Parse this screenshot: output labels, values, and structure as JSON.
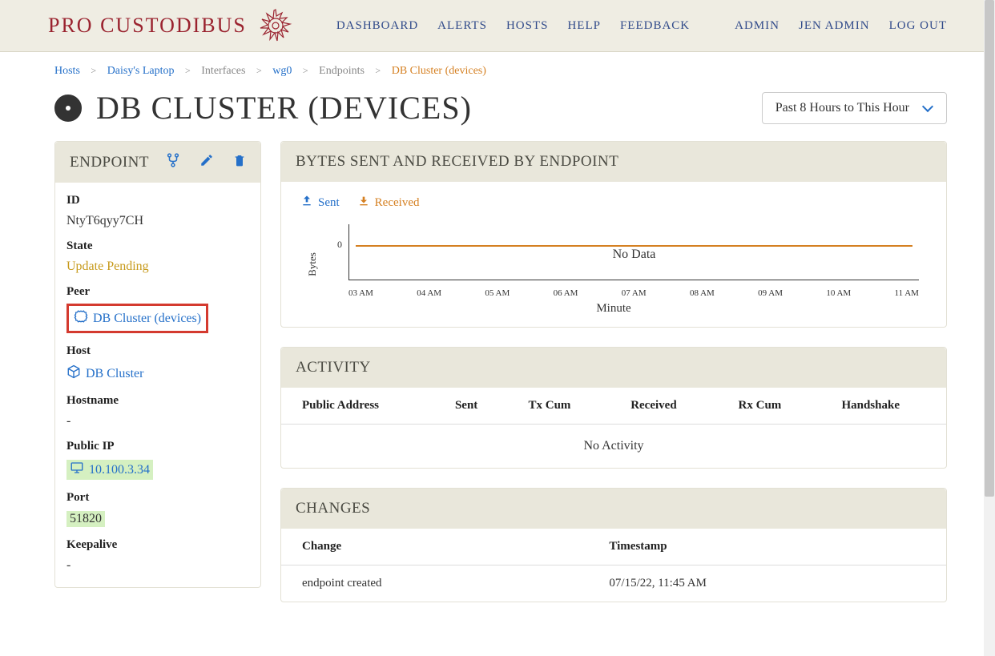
{
  "brand": "PRO CUSTODIBUS",
  "nav": {
    "dashboard": "DASHBOARD",
    "alerts": "ALERTS",
    "hosts": "HOSTS",
    "help": "HELP",
    "feedback": "FEEDBACK",
    "admin": "ADMIN",
    "jen_admin": "JEN ADMIN",
    "logout": "LOG OUT"
  },
  "breadcrumbs": {
    "hosts": "Hosts",
    "host": "Daisy's Laptop",
    "interfaces": "Interfaces",
    "iface": "wg0",
    "endpoints": "Endpoints",
    "current": "DB Cluster (devices)"
  },
  "page_title": "DB CLUSTER (DEVICES)",
  "time_range": "Past 8 Hours to This Hour",
  "endpoint_panel": {
    "title": "ENDPOINT",
    "fields": {
      "id_label": "ID",
      "id_value": "NtyT6qyy7CH",
      "state_label": "State",
      "state_value": "Update Pending",
      "peer_label": "Peer",
      "peer_value": "DB Cluster (devices)",
      "host_label": "Host",
      "host_value": "DB Cluster",
      "hostname_label": "Hostname",
      "hostname_value": "-",
      "public_ip_label": "Public IP",
      "public_ip_value": "10.100.3.34",
      "port_label": "Port",
      "port_value": "51820",
      "keepalive_label": "Keepalive",
      "keepalive_value": "-"
    }
  },
  "chart_panel": {
    "title": "BYTES SENT AND RECEIVED BY ENDPOINT",
    "legend_sent": "Sent",
    "legend_received": "Received",
    "y_label": "Bytes",
    "x_label": "Minute",
    "no_data": "No Data"
  },
  "chart_data": {
    "type": "line",
    "title": "Bytes Sent and Received by Endpoint",
    "xlabel": "Minute",
    "ylabel": "Bytes",
    "categories": [
      "03 AM",
      "04 AM",
      "05 AM",
      "06 AM",
      "07 AM",
      "08 AM",
      "09 AM",
      "10 AM",
      "11 AM"
    ],
    "series": [
      {
        "name": "Sent",
        "values": [
          0,
          0,
          0,
          0,
          0,
          0,
          0,
          0,
          0
        ],
        "color": "#2570c9"
      },
      {
        "name": "Received",
        "values": [
          0,
          0,
          0,
          0,
          0,
          0,
          0,
          0,
          0
        ],
        "color": "#d58022"
      }
    ],
    "ylim": [
      0,
      0
    ],
    "note": "No Data"
  },
  "activity_panel": {
    "title": "ACTIVITY",
    "columns": [
      "Public Address",
      "Sent",
      "Tx Cum",
      "Received",
      "Rx Cum",
      "Handshake"
    ],
    "empty": "No Activity"
  },
  "changes_panel": {
    "title": "CHANGES",
    "columns": [
      "Change",
      "Timestamp"
    ],
    "rows": [
      {
        "change": "endpoint created",
        "timestamp": "07/15/22, 11:45 AM"
      }
    ]
  }
}
